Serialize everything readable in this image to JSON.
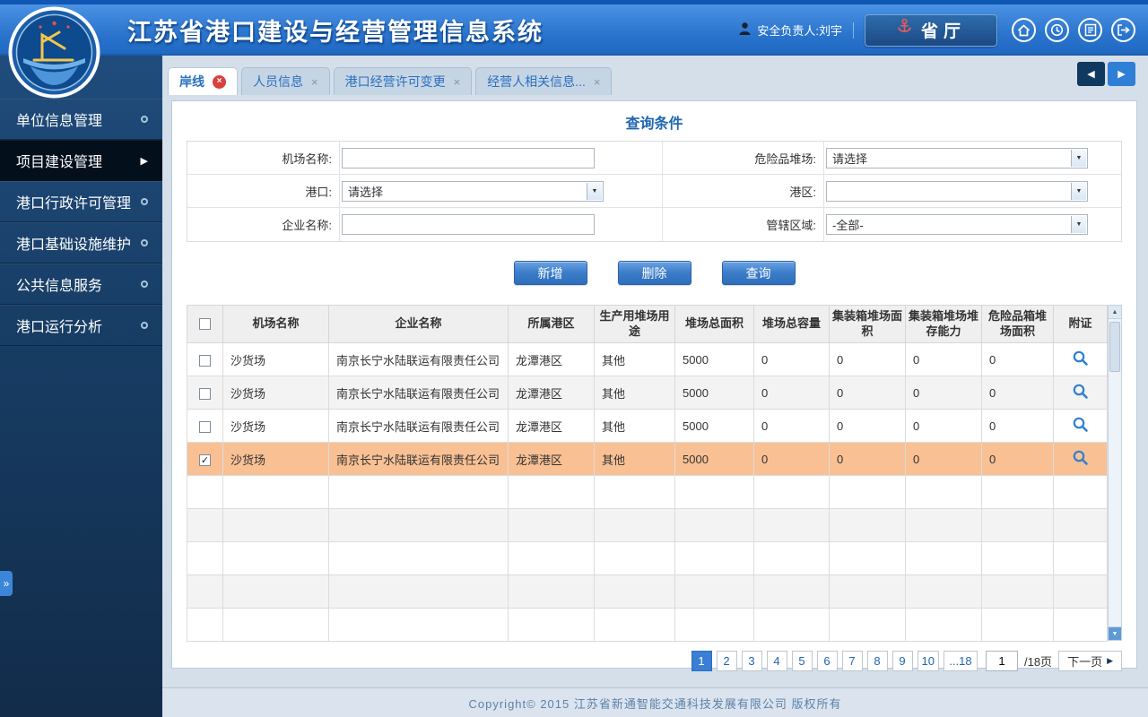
{
  "header": {
    "title": "江苏省港口建设与经营管理信息系统",
    "user_label": "安全负责人:刘宇",
    "org_button": "省厅"
  },
  "sidebar": {
    "items": [
      {
        "label": "单位信息管理",
        "active": false
      },
      {
        "label": "项目建设管理",
        "active": true
      },
      {
        "label": "港口行政许可管理",
        "active": false
      },
      {
        "label": "港口基础设施维护",
        "active": false
      },
      {
        "label": "公共信息服务",
        "active": false
      },
      {
        "label": "港口运行分析",
        "active": false
      }
    ]
  },
  "tabs": [
    {
      "label": "岸线",
      "active": true
    },
    {
      "label": "人员信息",
      "active": false
    },
    {
      "label": "港口经营许可变更",
      "active": false
    },
    {
      "label": "经营人相关信息...",
      "active": false
    }
  ],
  "query": {
    "title": "查询条件",
    "fields": {
      "airport_name": {
        "label": "机场名称:",
        "value": ""
      },
      "dangerous_yard": {
        "label": "危险品堆场:",
        "value": "请选择"
      },
      "port": {
        "label": "港口:",
        "value": "请选择"
      },
      "port_area": {
        "label": "港区:",
        "value": ""
      },
      "company_name": {
        "label": "企业名称:",
        "value": ""
      },
      "jurisdiction": {
        "label": "管辖区域:",
        "value": "-全部-"
      }
    },
    "buttons": {
      "add": "新增",
      "delete": "删除",
      "search": "查询"
    }
  },
  "table": {
    "headers": [
      "机场名称",
      "企业名称",
      "所属港区",
      "生产用堆场用途",
      "堆场总面积",
      "堆场总容量",
      "集装箱堆场面积",
      "集装箱堆场堆存能力",
      "危险品箱堆场面积",
      "附证"
    ],
    "rows": [
      {
        "checked": false,
        "selected": false,
        "cells": [
          "沙货场",
          "南京长宁水陆联运有限责任公司",
          "龙潭港区",
          "其他",
          "5000",
          "0",
          "0",
          "0",
          "0"
        ]
      },
      {
        "checked": false,
        "selected": false,
        "cells": [
          "沙货场",
          "南京长宁水陆联运有限责任公司",
          "龙潭港区",
          "其他",
          "5000",
          "0",
          "0",
          "0",
          "0"
        ]
      },
      {
        "checked": false,
        "selected": false,
        "cells": [
          "沙货场",
          "南京长宁水陆联运有限责任公司",
          "龙潭港区",
          "其他",
          "5000",
          "0",
          "0",
          "0",
          "0"
        ]
      },
      {
        "checked": true,
        "selected": true,
        "cells": [
          "沙货场",
          "南京长宁水陆联运有限责任公司",
          "龙潭港区",
          "其他",
          "5000",
          "0",
          "0",
          "0",
          "0"
        ]
      }
    ]
  },
  "pagination": {
    "pages": [
      "1",
      "2",
      "3",
      "4",
      "5",
      "6",
      "7",
      "8",
      "9",
      "10"
    ],
    "active_page": "1",
    "ellipsis_label": "...18",
    "page_input_value": "1",
    "total_pages_label": "/18页",
    "next_label": "下一页"
  },
  "footer": {
    "copyright": "Copyright©  2015  江苏省新通智能交通科技发展有限公司  版权所有"
  },
  "colors": {
    "accent_blue": "#2f7fd0",
    "selected_row": "#f9c094",
    "title_blue": "#1f66b0"
  }
}
